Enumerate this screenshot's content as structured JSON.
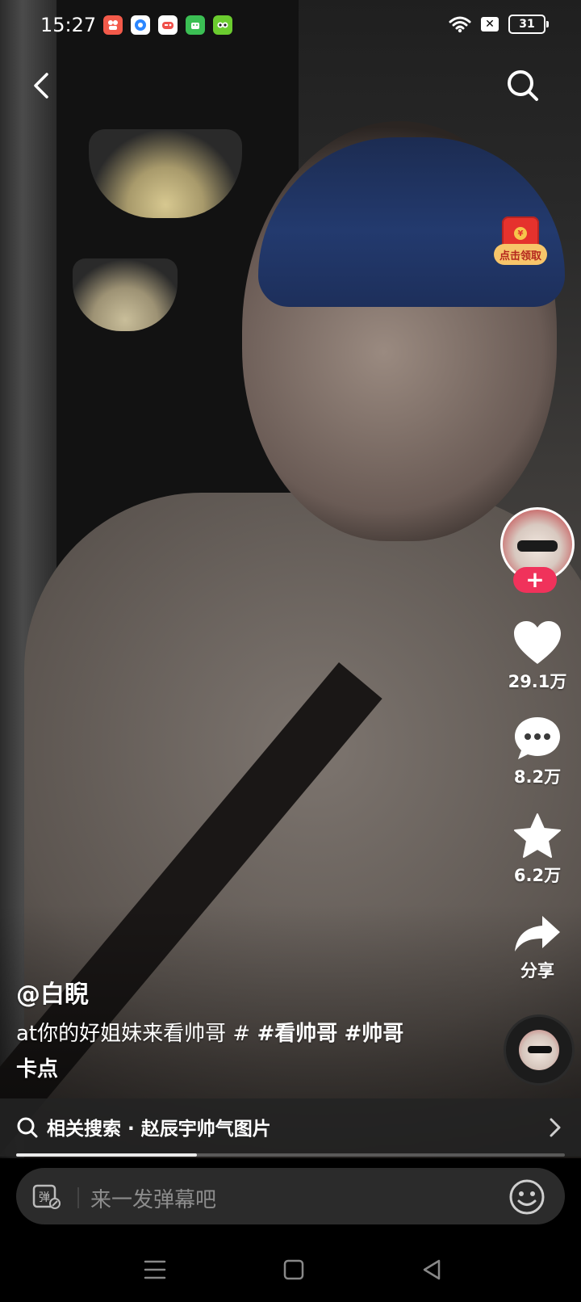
{
  "status_bar": {
    "time": "15:27",
    "app_icons": [
      "kuaishou-app-icon",
      "browser-app-icon",
      "game-app-icon",
      "android-app-icon",
      "duolingo-app-icon"
    ],
    "battery_level": "31"
  },
  "top_bar": {
    "back_icon": "back-arrow-icon",
    "search_icon": "search-icon"
  },
  "red_envelope": {
    "label": "点击领取",
    "coin_symbol": "¥"
  },
  "right_rail": {
    "follow_symbol": "+",
    "likes": "29.1万",
    "comments": "8.2万",
    "favorites": "6.2万",
    "share": "分享"
  },
  "caption": {
    "author": "@白睨",
    "text": "at你的好姐妹来看帅哥 # ",
    "tags": [
      "#看帅哥",
      "#帅哥"
    ],
    "text_end": "卡点"
  },
  "related_search": {
    "label": "相关搜索 · 赵辰宇帅气图片"
  },
  "playback": {
    "progress": 0.33
  },
  "danmu": {
    "icon_label": "弹",
    "placeholder": "来一发弹幕吧"
  },
  "colors": {
    "follow_red": "#f0325b",
    "envelope_red": "#e5322d",
    "envelope_gold": "#f7c56a"
  }
}
